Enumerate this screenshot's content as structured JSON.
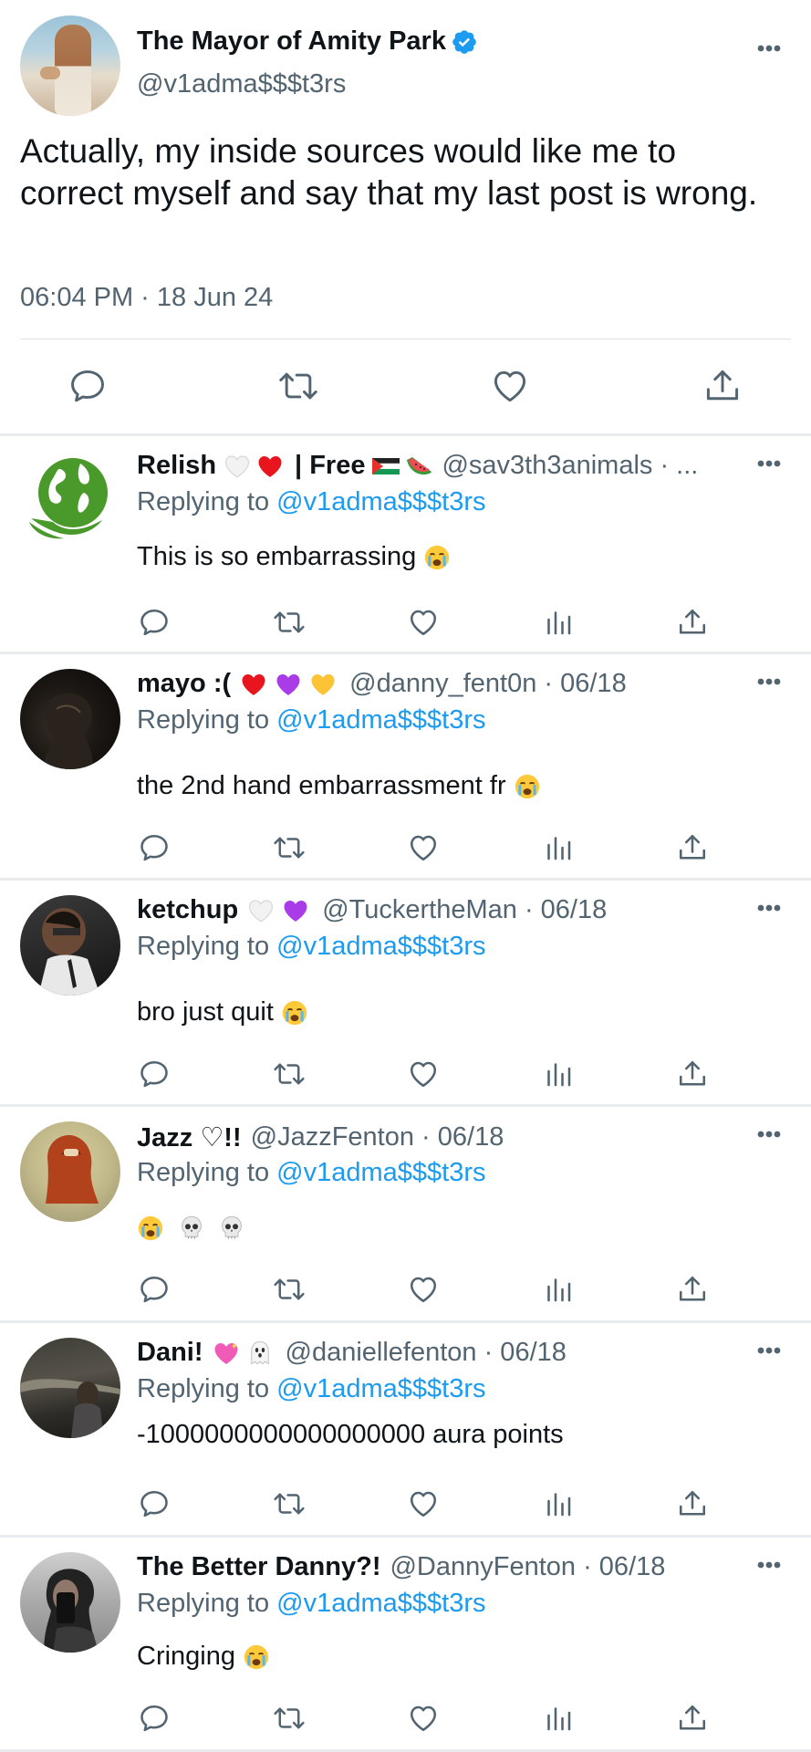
{
  "main_post": {
    "name": "The Mayor of Amity Park",
    "handle": "@v1adma$$$t3rs",
    "text": "Actually, my inside sources would like me to correct myself and say that my last post is wrong.",
    "timestamp": "06:04 PM · 18 Jun 24"
  },
  "replies": [
    {
      "name": "Relish",
      "name_extra": "| Free",
      "handle": "@sav3th3animals · ...",
      "replying_prefix": "Replying to",
      "replying_mention": "@v1adma$$$t3rs",
      "text": "This is so embarrassing"
    },
    {
      "name": "mayo :(",
      "handle": "@danny_fent0n · 06/18",
      "replying_prefix": "Replying to",
      "replying_mention": "@v1adma$$$t3rs",
      "text": "the 2nd hand embarrassment fr"
    },
    {
      "name": "ketchup",
      "handle": "@TuckertheMan · 06/18",
      "replying_prefix": "Replying to",
      "replying_mention": "@v1adma$$$t3rs",
      "text": "bro just quit"
    },
    {
      "name": "Jazz ♡!!",
      "handle": "@JazzFenton · 06/18",
      "replying_prefix": "Replying to",
      "replying_mention": "@v1adma$$$t3rs",
      "text": ""
    },
    {
      "name": "Dani!",
      "handle": "@daniellefenton · 06/18",
      "replying_prefix": "Replying to",
      "replying_mention": "@v1adma$$$t3rs",
      "text": "-1000000000000000000 aura points"
    },
    {
      "name": "The Better Danny?!",
      "handle": "@DannyFenton · 06/18",
      "replying_prefix": "Replying to",
      "replying_mention": "@v1adma$$$t3rs",
      "text": "Cringing"
    }
  ],
  "icons": {
    "reply": "reply-icon",
    "retweet": "retweet-icon",
    "like": "heart-icon",
    "views": "views-icon",
    "share": "share-icon",
    "more": "more-icon",
    "verified": "verified-badge-icon"
  },
  "colors": {
    "accent": "#1d9bf0",
    "text": "#0f1419",
    "secondary": "#536471"
  }
}
